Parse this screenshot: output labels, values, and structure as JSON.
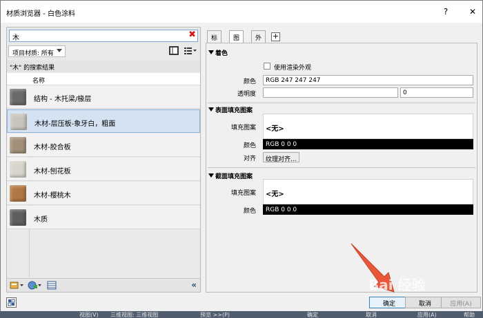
{
  "window": {
    "title": "材质浏览器 - 白色涂料",
    "help_label": "?",
    "close_label": "✕"
  },
  "search": {
    "value": "木",
    "clear_label": "✖"
  },
  "filter": {
    "crumb_label": "项目材质: 所有"
  },
  "results": {
    "header": "\"木\" 的搜索结果",
    "column_name": "名称",
    "items": [
      {
        "label": "结构 - 木托梁/椽层",
        "swatch": "#6a6a6a"
      },
      {
        "label": "木材-层压板-象牙白，粗面",
        "swatch": "#c9c5bd"
      },
      {
        "label": "木材-胶合板",
        "swatch": "#a2907a"
      },
      {
        "label": "木材-刨花板",
        "swatch": "#d8d5cc"
      },
      {
        "label": "木材-樱桃木",
        "swatch": "#b07845"
      },
      {
        "label": "木质",
        "swatch": "#5e5e5e"
      }
    ],
    "selected_index": 1
  },
  "tabs": [
    {
      "label": "标识"
    },
    {
      "label": "图形"
    },
    {
      "label": "外观"
    }
  ],
  "tab_add_label": "+",
  "graphics": {
    "shading": {
      "title": "着色",
      "use_render_label": "使用渲染外观",
      "color_label": "颜色",
      "color_value": "RGB 247 247 247",
      "transparency_label": "透明度",
      "transparency_value": "0"
    },
    "surface": {
      "title": "表面填充图案",
      "pattern_label": "填充图案",
      "pattern_value": "<无>",
      "color_label": "颜色",
      "color_value": "RGB 0 0 0",
      "align_label": "对齐",
      "align_button": "纹理对齐..."
    },
    "cut": {
      "title": "截面填充图案",
      "pattern_label": "填充图案",
      "pattern_value": "<无>",
      "color_label": "颜色",
      "color_value": "RGB 0 0 0"
    }
  },
  "footer": {
    "ok_label": "确定",
    "cancel_label": "取消",
    "apply_label": "应用(A)"
  },
  "background": {
    "items": [
      "视图(V)",
      "三维视图: 三维视图",
      "预览 >>(P)",
      "确定",
      "取消",
      "应用(A)",
      "帮助"
    ]
  },
  "watermark": "Bai 经验",
  "colors": {
    "selected_row": "#d4e2f2",
    "arrow": "#e8573a",
    "clear_icon": "#d51919"
  }
}
